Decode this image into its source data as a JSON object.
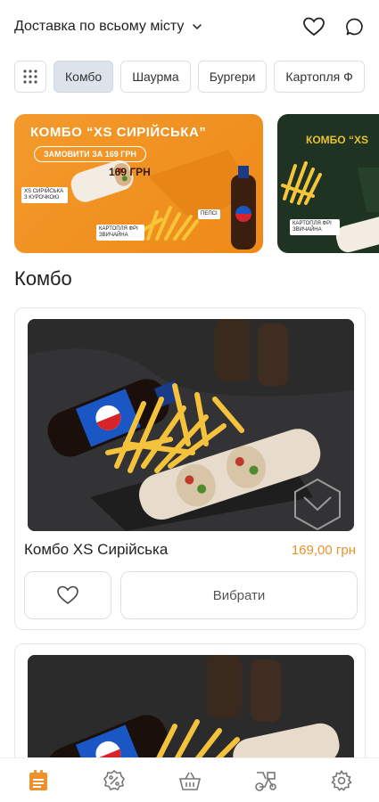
{
  "header": {
    "delivery_label": "Доставка по всьому місту",
    "icons": [
      "chevron-down-icon",
      "heart-icon",
      "chat-icon"
    ]
  },
  "categories": {
    "grid_icon": "grid-icon",
    "items": [
      {
        "label": "Комбо",
        "active": true
      },
      {
        "label": "Шаурма",
        "active": false
      },
      {
        "label": "Бургери",
        "active": false
      },
      {
        "label": "Картопля Ф",
        "active": false
      }
    ]
  },
  "banners": [
    {
      "title": "КОМБО “XS СИРІЙСЬКА”",
      "cta": "ЗАМОВИТИ ЗА 169 ГРН",
      "price": "169 ГРН",
      "tags": [
        "XS СИРІЙСЬКА З КУРОЧКОЮ",
        "КАРТОПЛЯ ФРІ ЗВИЧАЙНА",
        "ПЕПСІ"
      ],
      "bg": "#f1921f"
    },
    {
      "title": "КОМБО “XS",
      "tags": [
        "КАРТОПЛЯ ФРІ ЗВИЧАЙНА"
      ],
      "bg": "#1f3323"
    }
  ],
  "section": {
    "title": "Комбо"
  },
  "products": [
    {
      "name": "Комбо XS Сирійська",
      "price": "169,00 грн",
      "choose_label": "Вибрати",
      "fav_icon": "heart-icon"
    }
  ],
  "bottom_nav": [
    {
      "icon": "menu-list-icon",
      "active": true
    },
    {
      "icon": "discount-icon",
      "active": false
    },
    {
      "icon": "basket-icon",
      "active": false
    },
    {
      "icon": "delivery-bike-icon",
      "active": false
    },
    {
      "icon": "settings-icon",
      "active": false
    }
  ],
  "colors": {
    "accent": "#e8922a",
    "chip_active_bg": "#dde3ea",
    "nav_active": "#f0902a"
  }
}
